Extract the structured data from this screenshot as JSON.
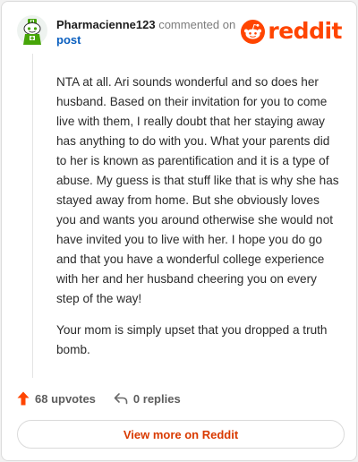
{
  "comment": {
    "username": "Pharmacienne123",
    "action_text": "commented on",
    "target_text": "post",
    "paragraphs": [
      "NTA at all. Ari sounds wonderful and so does her husband. Based on their invitation for you to come live with them, I really doubt that her staying away has anything to do with you. What your parents did to her is known as parentification and it is a type of abuse. My guess is that stuff like that is why she has stayed away from home. But she obviously loves you and wants you around otherwise she would not have invited you to live with her. I hope you do go and that you have a wonderful college experience with her and her husband cheering you on every step of the way!",
      "Your mom is simply upset that you dropped a truth bomb."
    ]
  },
  "brand": {
    "wordmark": "reddit",
    "color": "#ff4500"
  },
  "stats": {
    "upvotes": "68 upvotes",
    "replies": "0 replies",
    "upvote_icon": "upvote-arrow-icon",
    "reply_icon": "reply-icon"
  },
  "footer": {
    "view_more_label": "View more on Reddit"
  },
  "colors": {
    "accent": "#ff4500",
    "link": "#0a5fbf",
    "avatar_green": "#46a508"
  }
}
